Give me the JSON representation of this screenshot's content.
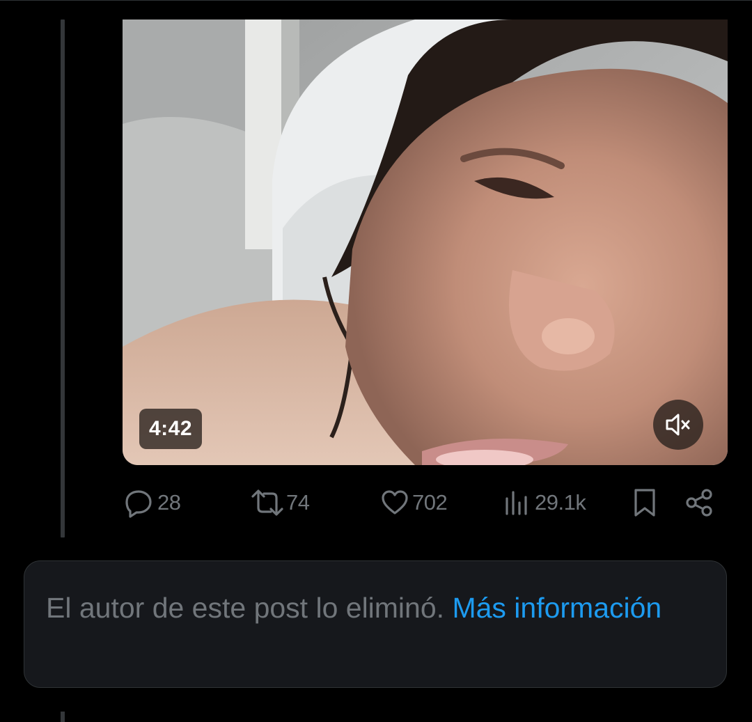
{
  "video": {
    "duration": "4:42",
    "mute_icon": "speaker-muted-icon"
  },
  "actions": {
    "replies": {
      "icon": "reply-icon",
      "count": "28"
    },
    "reposts": {
      "icon": "repost-icon",
      "count": "74"
    },
    "likes": {
      "icon": "heart-icon",
      "count": "702"
    },
    "views": {
      "icon": "views-icon",
      "count": "29.1k"
    },
    "bookmark": {
      "icon": "bookmark-icon"
    },
    "share": {
      "icon": "share-icon"
    }
  },
  "notice": {
    "text": "El autor de este post lo eliminó.",
    "link_label": "Más información"
  },
  "colors": {
    "background": "#000000",
    "muted_text": "#71767b",
    "link": "#1d9bf0",
    "notice_bg": "#16181c",
    "border": "#2f3336"
  }
}
